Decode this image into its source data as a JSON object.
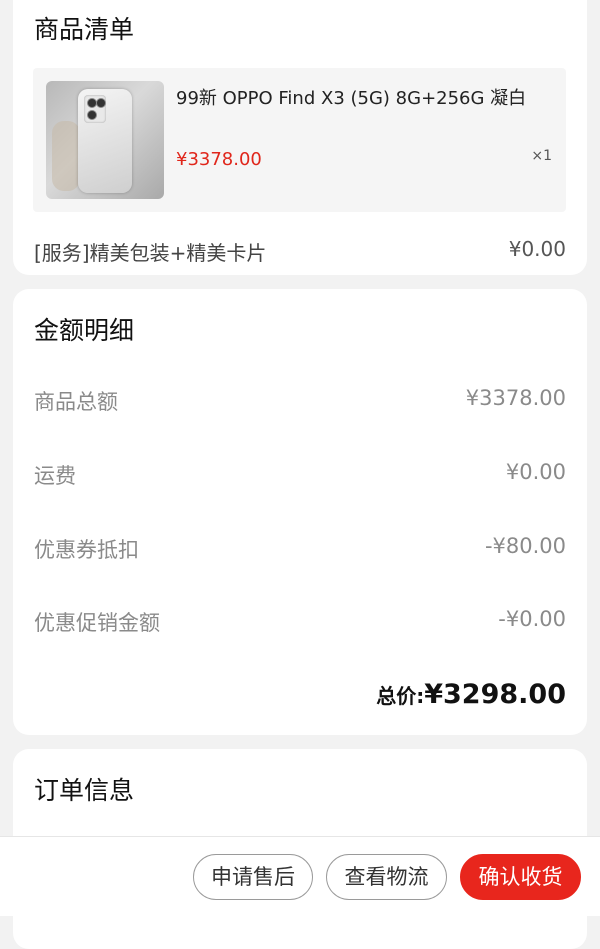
{
  "goods_section": {
    "title": "商品清单",
    "product": {
      "name": "99新 OPPO Find X3 (5G) 8G+256G 凝白",
      "price": "¥3378.00",
      "quantity": "×1",
      "image": "phone-photo"
    },
    "service": {
      "label": "[服务]精美包装+精美卡片",
      "value": "¥0.00"
    }
  },
  "amount_section": {
    "title": "金额明细",
    "rows": [
      {
        "label": "商品总额",
        "value": "¥3378.00"
      },
      {
        "label": "运费",
        "value": "¥0.00"
      },
      {
        "label": "优惠券抵扣",
        "value": "-¥80.00"
      },
      {
        "label": "优惠促销金额",
        "value": "-¥0.00"
      }
    ],
    "total_label": "总价:",
    "total_value": "¥3298.00"
  },
  "order_section": {
    "title": "订单信息"
  },
  "actions": {
    "after_sale": "申请售后",
    "logistics": "查看物流",
    "confirm": "确认收货"
  },
  "colors": {
    "accent_red": "#e8261d",
    "price_red": "#e0261b"
  }
}
